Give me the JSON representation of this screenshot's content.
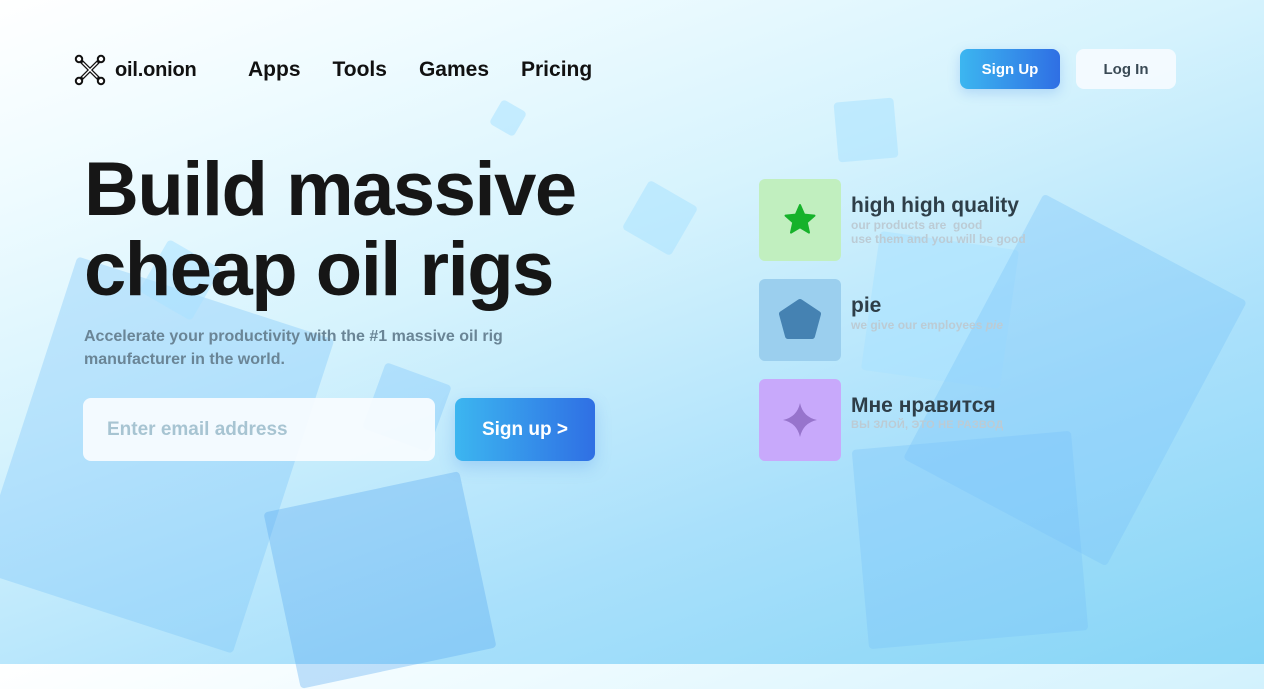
{
  "brand": {
    "name": "oil.onion",
    "logo_icon": "crossed-bones-logo-icon"
  },
  "nav": {
    "items": [
      {
        "label": "Apps"
      },
      {
        "label": "Tools"
      },
      {
        "label": "Games"
      },
      {
        "label": "Pricing"
      }
    ]
  },
  "header": {
    "signup_label": "Sign Up",
    "login_label": "Log In"
  },
  "hero": {
    "title_line1": "Build massive",
    "title_line2": "cheap oil rigs",
    "subtitle": "Accelerate your productivity with the #1 massive oil rig manufacturer in the world.",
    "email_placeholder": "Enter email address",
    "signup_label": "Sign up >"
  },
  "features": [
    {
      "title": "high high quality",
      "desc_line1": "our products are  good",
      "desc_line2": "use them and you will be good",
      "icon": "star-icon",
      "tile_color": "#c1efbf",
      "icon_color": "#16b22a"
    },
    {
      "title": "pie",
      "desc_prefix": "we give our employees ",
      "desc_emphasis": "pie",
      "icon": "pentagon-icon",
      "tile_color": "#9bcfee",
      "icon_color": "#4582b2"
    },
    {
      "title": "Мне нравится",
      "desc_line1": "ВЫ ЗЛОЙ, ЭТО НЕ РАЗВОД",
      "icon": "sparkle-icon",
      "tile_color": "#c8a9fb",
      "icon_color": "#9774cc"
    }
  ],
  "colors": {
    "accent_gradient_start": "#3cb6f0",
    "accent_gradient_end": "#2f6fe4",
    "text_dark": "#161616",
    "text_muted": "#6a8596"
  }
}
